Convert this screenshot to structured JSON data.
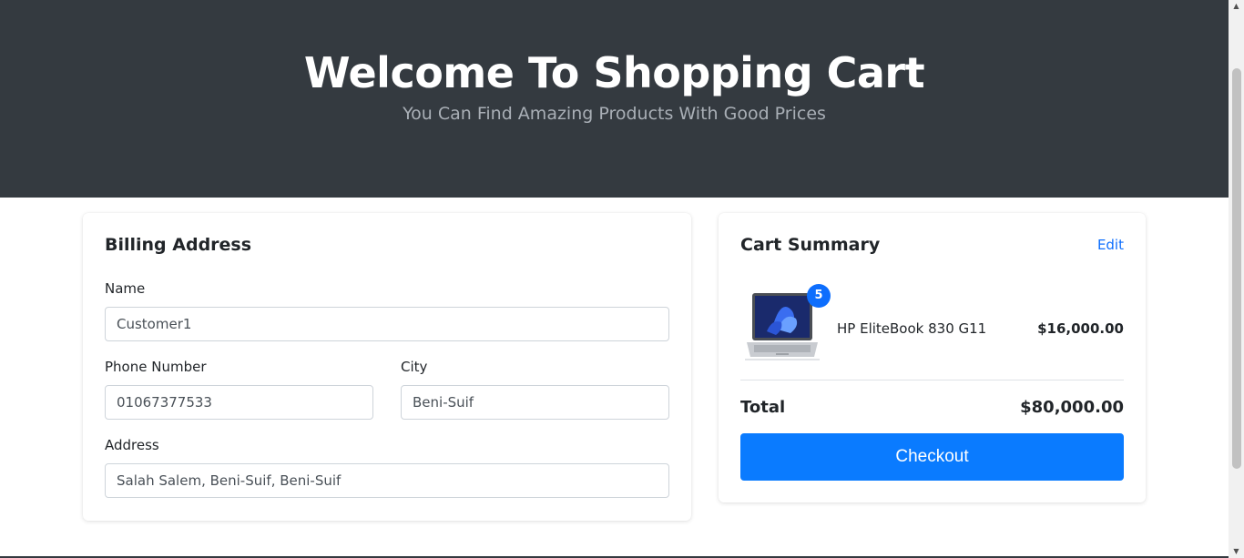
{
  "hero": {
    "title": "Welcome To Shopping Cart",
    "subtitle": "You Can Find Amazing Products With Good Prices"
  },
  "billing": {
    "title": "Billing Address",
    "name_label": "Name",
    "name_value": "Customer1",
    "phone_label": "Phone Number",
    "phone_value": "01067377533",
    "city_label": "City",
    "city_value": "Beni-Suif",
    "address_label": "Address",
    "address_value": "Salah Salem, Beni-Suif, Beni-Suif"
  },
  "summary": {
    "title": "Cart Summary",
    "edit_label": "Edit",
    "items": [
      {
        "name": "HP EliteBook 830 G11",
        "price": "$16,000.00",
        "quantity": "5"
      }
    ],
    "total_label": "Total",
    "total_value": "$80,000.00",
    "checkout_label": "Checkout"
  },
  "colors": {
    "hero_bg": "#343a40",
    "accent": "#0a7bff",
    "link": "#0d6efd"
  }
}
